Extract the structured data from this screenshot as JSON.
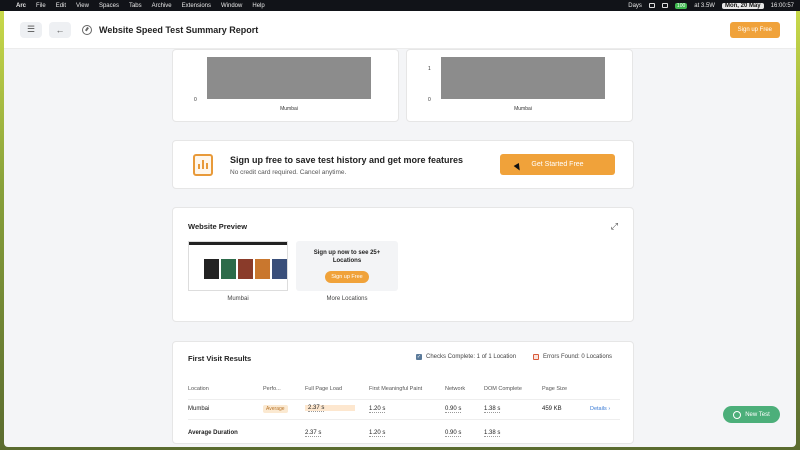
{
  "menubar": {
    "app": "Arc",
    "items": [
      "File",
      "Edit",
      "View",
      "Spaces",
      "Tabs",
      "Archive",
      "Extensions",
      "Window",
      "Help"
    ],
    "right": {
      "days": "Days",
      "battery": "100",
      "weather": "at 3.5W",
      "date": "Mon, 20 May",
      "time": "16:00:57"
    }
  },
  "header": {
    "title": "Website Speed Test Summary Report",
    "signup": "Sign up Free"
  },
  "chart_data": [
    {
      "type": "bar",
      "categories": [
        "Mumbai"
      ],
      "values": [
        1
      ],
      "ytick_labels": [
        "0"
      ],
      "ylim": [
        0,
        1
      ]
    },
    {
      "type": "bar",
      "categories": [
        "Mumbai"
      ],
      "values": [
        1
      ],
      "ytick_labels": [
        "1",
        "0"
      ],
      "ylim": [
        0,
        1
      ]
    }
  ],
  "promo": {
    "title": "Sign up free to save test history and get more features",
    "subtitle": "No credit card required. Cancel anytime.",
    "button": "Get Started Free"
  },
  "preview": {
    "title": "Website Preview",
    "thumb_label": "Mumbai",
    "more_text": "Sign up now to see 25+ Locations",
    "more_button": "Sign up Free",
    "more_label": "More Locations"
  },
  "results": {
    "title": "First Visit Results",
    "checks": "Checks Complete: 1 of 1 Location",
    "errors": "Errors Found: 0 Locations",
    "columns": [
      "Location",
      "Perfo...",
      "Full Page Load",
      "First Meaningful Paint",
      "Network",
      "DOM Complete",
      "Page Size"
    ],
    "row": {
      "location": "Mumbai",
      "performance": "Average",
      "full_load": "2.37 s",
      "fmp": "1.20 s",
      "network": "0.90 s",
      "dom": "1.38 s",
      "size": "459 KB",
      "details": "Details ›"
    },
    "avg": {
      "label": "Average Duration",
      "full_load": "2.37 s",
      "fmp": "1.20 s",
      "network": "0.90 s",
      "dom": "1.38 s"
    }
  },
  "new_test": "New Test",
  "colors": {
    "accent": "#f0a23a",
    "bar": "#8c8c8c",
    "success": "#4caf7a",
    "link": "#3a7bd5"
  }
}
